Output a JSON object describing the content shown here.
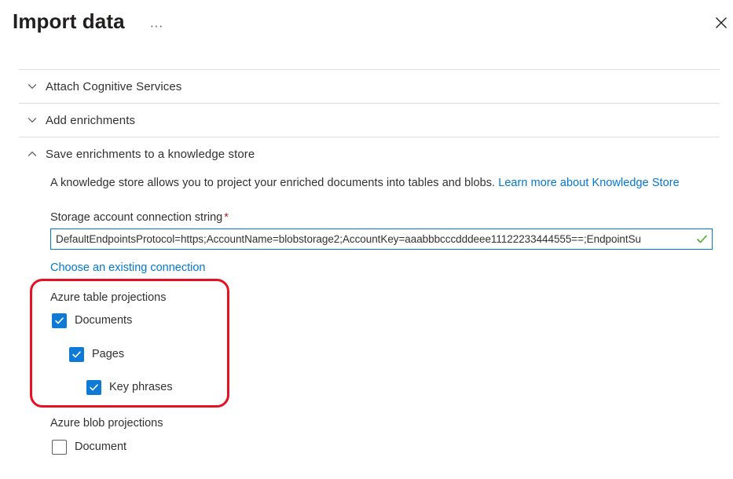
{
  "header": {
    "title": "Import data",
    "more_menu_label": "···",
    "more_menu_name": "more-options",
    "close_label": "Close"
  },
  "sections": [
    {
      "label": "Attach Cognitive Services",
      "expanded": false,
      "icon": "chevron-down-icon"
    },
    {
      "label": "Add enrichments",
      "expanded": false,
      "icon": "chevron-down-icon"
    },
    {
      "label": "Save enrichments to a knowledge store",
      "expanded": true,
      "icon": "chevron-up-icon"
    }
  ],
  "knowledge_store": {
    "description": "A knowledge store allows you to project your enriched documents into tables and blobs.",
    "learn_more_link": "Learn more about Knowledge Store",
    "connection": {
      "label": "Storage account connection string",
      "required_marker": "*",
      "value": "DefaultEndpointsProtocol=https;AccountName=blobstorage2;AccountKey=aaabbbcccdddeee11122233444555==;EndpointSu",
      "placeholder": "Storage account connection string",
      "validation_state": "valid",
      "validation_icon": "green-check-icon"
    },
    "existing_connection_link": "Choose an existing connection",
    "table_projections": {
      "title": "Azure table projections",
      "items": [
        {
          "label": "Documents",
          "checked": true,
          "indent": 0
        },
        {
          "label": "Pages",
          "checked": true,
          "indent": 1
        },
        {
          "label": "Key phrases",
          "checked": true,
          "indent": 2
        }
      ]
    },
    "blob_projections": {
      "title": "Azure blob projections",
      "items": [
        {
          "label": "Document",
          "checked": false,
          "indent": 0
        }
      ]
    }
  },
  "annotation": {
    "type": "red-rounded-rect-highlight",
    "color": "#e81123",
    "targets": "Azure table projections"
  },
  "colors": {
    "accent": "#0078d4",
    "checkbox_fill": "#0f7ad6",
    "link": "#0078d4",
    "required": "#a4262c",
    "divider": "#e1dfdd",
    "text": "#323130",
    "annotation": "#e81123",
    "valid_check": "#4caf28"
  }
}
